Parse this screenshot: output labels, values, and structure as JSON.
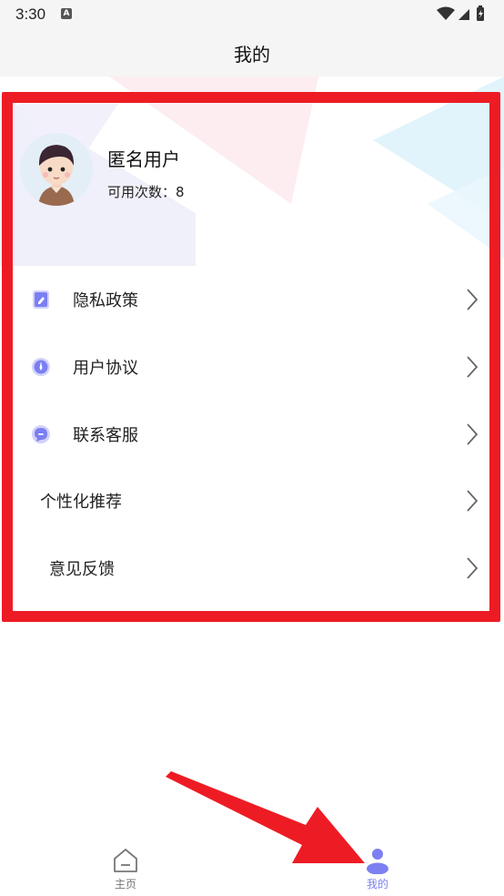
{
  "status_bar": {
    "time": "3:30",
    "notification_glyph": "A"
  },
  "header": {
    "title": "我的"
  },
  "profile": {
    "name": "匿名用户",
    "usage_label": "可用次数：",
    "usage_count": "8"
  },
  "menu": {
    "items": [
      {
        "label": "隐私政策",
        "icon": "document-edit-icon"
      },
      {
        "label": "用户协议",
        "icon": "compass-icon"
      },
      {
        "label": "联系客服",
        "icon": "chat-icon"
      },
      {
        "label": "个性化推荐",
        "icon": ""
      },
      {
        "label": "意见反馈",
        "icon": ""
      }
    ]
  },
  "tab_bar": {
    "tabs": [
      {
        "label": "主页",
        "icon": "home-icon",
        "active": false
      },
      {
        "label": "我的",
        "icon": "person-icon",
        "active": true
      }
    ]
  },
  "colors": {
    "accent": "#7b7ff2",
    "annotation_red": "#ed1c24",
    "inactive_tab": "#777777"
  }
}
